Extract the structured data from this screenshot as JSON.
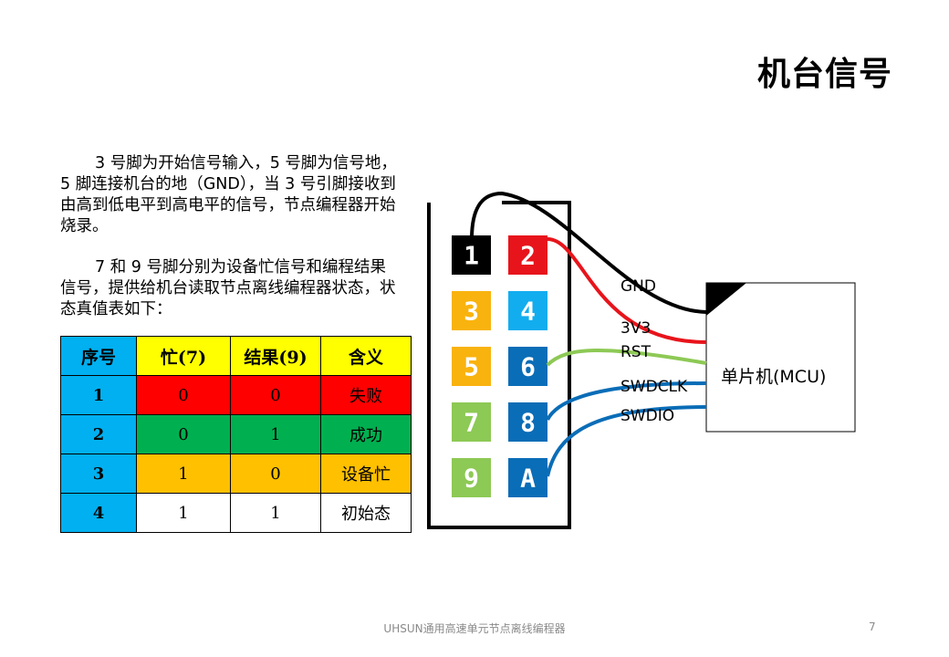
{
  "title": "机台信号",
  "paragraphs": [
    "3 号脚为开始信号输入，5 号脚为信号地，5 脚连接机台的地（GND），当 3 号引脚接收到由高到低电平到高电平的信号，节点编程器开始烧录。",
    "7 和 9 号脚分别为设备忙信号和编程结果信号，提供给机台读取节点离线编程器状态，状态真值表如下："
  ],
  "table": {
    "headers": [
      "序号",
      "忙(7)",
      "结果(9)",
      "含义"
    ],
    "rows": [
      [
        "1",
        "0",
        "0",
        "失败"
      ],
      [
        "2",
        "0",
        "1",
        "成功"
      ],
      [
        "3",
        "1",
        "0",
        "设备忙"
      ],
      [
        "4",
        "1",
        "1",
        "初始态"
      ]
    ]
  },
  "colors": {
    "header_blue": "#00B0F0",
    "header_yellow": "#FFFF00",
    "fail_red": "#FF0000",
    "success_green": "#00B050",
    "busy_orange": "#FFC000"
  },
  "connector": {
    "pins": [
      {
        "label": "1",
        "color": "#000000"
      },
      {
        "label": "2",
        "color": "#E8141B"
      },
      {
        "label": "3",
        "color": "#F9B30F"
      },
      {
        "label": "4",
        "color": "#12ADEF"
      },
      {
        "label": "5",
        "color": "#F9B30F"
      },
      {
        "label": "6",
        "color": "#0A6DB7"
      },
      {
        "label": "7",
        "color": "#8DC955"
      },
      {
        "label": "8",
        "color": "#0A6DB7"
      },
      {
        "label": "9",
        "color": "#8DC955"
      },
      {
        "label": "A",
        "color": "#0A6DB7"
      }
    ]
  },
  "signals": [
    "GND",
    "3V3",
    "RST",
    "SWDCLK",
    "SWDIO"
  ],
  "mcu_label": "单片机(MCU)",
  "footer": "UHSUN通用高速单元节点离线编程器",
  "page_number": "7"
}
